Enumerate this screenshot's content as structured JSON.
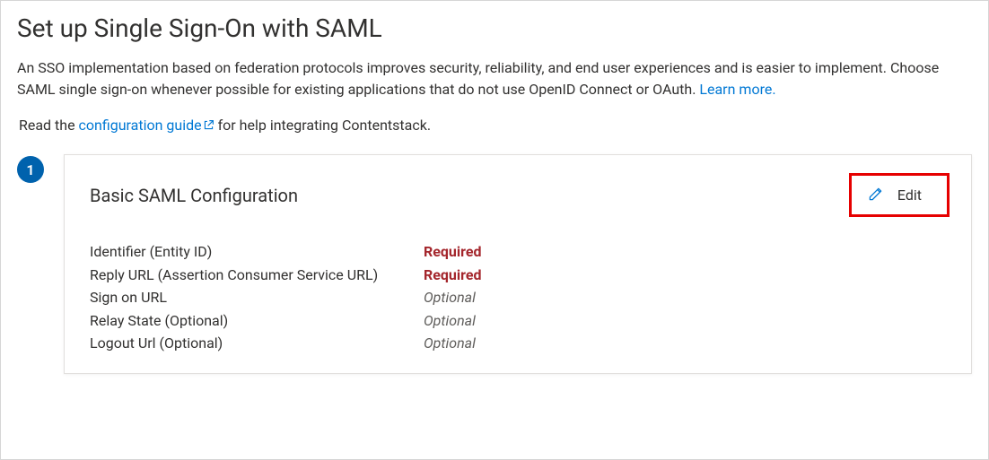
{
  "page": {
    "title": "Set up Single Sign-On with SAML",
    "intro_part1": "An SSO implementation based on federation protocols improves security, reliability, and end user experiences and is easier to implement. Choose SAML single sign-on whenever possible for existing applications that do not use OpenID Connect or OAuth. ",
    "learn_more": "Learn more.",
    "guide_prefix": "Read the ",
    "guide_link": "configuration guide",
    "guide_suffix": " for help integrating Contentstack."
  },
  "step": {
    "number": "1",
    "title": "Basic SAML Configuration",
    "edit_label": "Edit",
    "fields": {
      "f0": {
        "label": "Identifier (Entity ID)",
        "value": "Required",
        "optional": false
      },
      "f1": {
        "label": "Reply URL (Assertion Consumer Service URL)",
        "value": "Required",
        "optional": false
      },
      "f2": {
        "label": "Sign on URL",
        "value": "Optional",
        "optional": true
      },
      "f3": {
        "label": "Relay State (Optional)",
        "value": "Optional",
        "optional": true
      },
      "f4": {
        "label": "Logout Url (Optional)",
        "value": "Optional",
        "optional": true
      }
    }
  }
}
